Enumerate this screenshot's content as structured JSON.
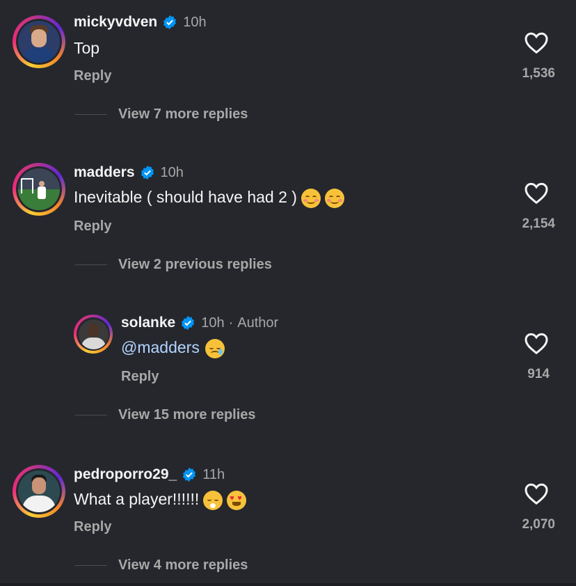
{
  "comments": [
    {
      "username": "mickyvdven",
      "time": "10h",
      "text": "Top",
      "reply": "Reply",
      "likes": "1,536",
      "view_more": "View 7 more replies",
      "avatar_colors": {
        "jersey": "#1f3f7a",
        "skin": "#d8a98a",
        "hair": "#5a3b24",
        "bg": "#2c3d6a"
      }
    },
    {
      "username": "madders",
      "time": "10h",
      "text": "Inevitable ( should have had 2 )",
      "emojis": [
        "smiling-face-emoji",
        "smiling-face-emoji"
      ],
      "reply": "Reply",
      "likes": "2,154",
      "view_more": "View 2 previous replies",
      "avatar_colors": {
        "pitch": "#3a7d3a",
        "stand": "#3b4556",
        "player": "#ffffff"
      }
    },
    {
      "username": "solanke",
      "time": "10h",
      "author_sep": "·",
      "author_label": "Author",
      "mention": "@madders",
      "emojis": [
        "crying-face-emoji"
      ],
      "reply": "Reply",
      "likes": "914",
      "view_more": "View 15 more replies",
      "avatar_colors": {
        "bg": "#3a3a3a",
        "skin": "#4a3428",
        "shirt": "#d9d9d9"
      }
    },
    {
      "username": "pedroporro29_",
      "time": "11h",
      "text": "What a player!!!!!!",
      "emojis": [
        "face-exhaling-emoji",
        "heart-eyes-emoji"
      ],
      "reply": "Reply",
      "likes": "2,070",
      "view_more": "View 4 more replies",
      "avatar_colors": {
        "bg": "#2d4a52",
        "skin": "#c89376",
        "shirt": "#f2f2f2"
      }
    }
  ],
  "colors": {
    "background": "#25272d",
    "verified": "#0095f6",
    "secondary_text": "#a8a8a8",
    "mention": "#b3d4ff"
  }
}
